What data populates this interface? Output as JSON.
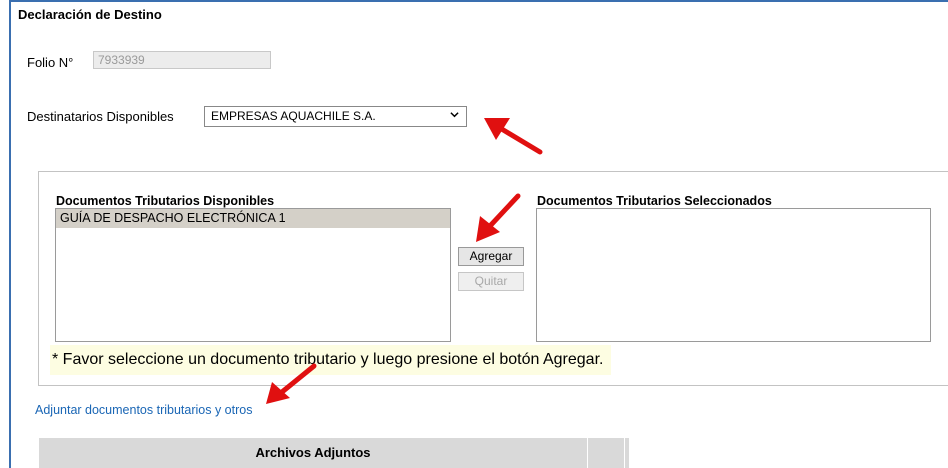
{
  "form": {
    "title": "Declaración de Destino",
    "folio_label": "Folio N°",
    "folio_value": "7933939",
    "destinatarios_label": "Destinatarios Disponibles",
    "destinatarios_selected": "EMPRESAS AQUACHILE S.A."
  },
  "documents": {
    "available_title": "Documentos Tributarios Disponibles",
    "available_items": [
      "GUÍA DE DESPACHO ELECTRÓNICA 1"
    ],
    "selected_title": "Documentos Tributarios Seleccionados",
    "add_button": "Agregar",
    "remove_button": "Quitar",
    "hint": "* Favor seleccione un documento tributario y luego presione el botón Agregar."
  },
  "attach_link": "Adjuntar documentos tributarios y otros",
  "attachments_table": {
    "header": "Archivos Adjuntos"
  },
  "colors": {
    "accent_border": "#3a6fb0",
    "link": "#1a66b5",
    "annotation_arrow": "#e01010",
    "hint_background": "#fdfde2"
  },
  "icons": {
    "select_chevron": "chevron-down-icon",
    "annotation": "red-arrow-icon"
  }
}
